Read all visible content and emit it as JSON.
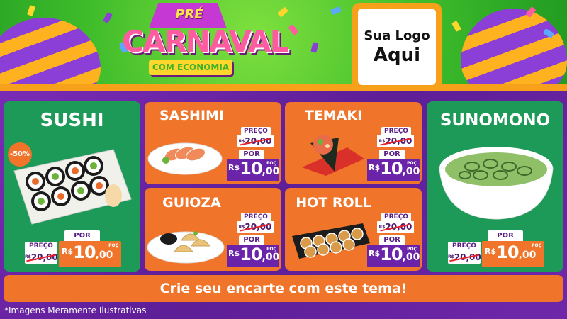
{
  "banner": {
    "title_pre": "PRÉ",
    "title_main": "CARNAVAL",
    "title_sub": "COM ECONOMIA"
  },
  "logo": {
    "line1": "Sua Logo",
    "line2": "Aqui"
  },
  "labels": {
    "preco": "PREÇO",
    "por": "POR",
    "currency": "R$",
    "unit": "POÇ"
  },
  "products": [
    {
      "name": "SUSHI",
      "old_price_int": "20",
      "old_price_cents": ",00",
      "new_price_int": "10",
      "new_price_cents": ",00",
      "discount": "-50%"
    },
    {
      "name": "SASHIMI",
      "old_price_int": "20",
      "old_price_cents": ",00",
      "new_price_int": "10",
      "new_price_cents": ",00"
    },
    {
      "name": "TEMAKI",
      "old_price_int": "20",
      "old_price_cents": ",00",
      "new_price_int": "10",
      "new_price_cents": ",00"
    },
    {
      "name": "GUIOZA",
      "old_price_int": "20",
      "old_price_cents": ",00",
      "new_price_int": "10",
      "new_price_cents": ",00"
    },
    {
      "name": "HOT ROLL",
      "old_price_int": "20",
      "old_price_cents": ",00",
      "new_price_int": "10",
      "new_price_cents": ",00"
    },
    {
      "name": "SUNOMONO",
      "old_price_int": "20",
      "old_price_cents": ",00",
      "new_price_int": "10",
      "new_price_cents": ",00"
    }
  ],
  "cta": "Crie seu encarte com este tema!",
  "footer": "*Imagens Meramente Ilustrativas",
  "colors": {
    "green": "#1e9a58",
    "orange": "#f0742a",
    "purple": "#6b23a9",
    "banner_green": "#3dbb2a"
  }
}
